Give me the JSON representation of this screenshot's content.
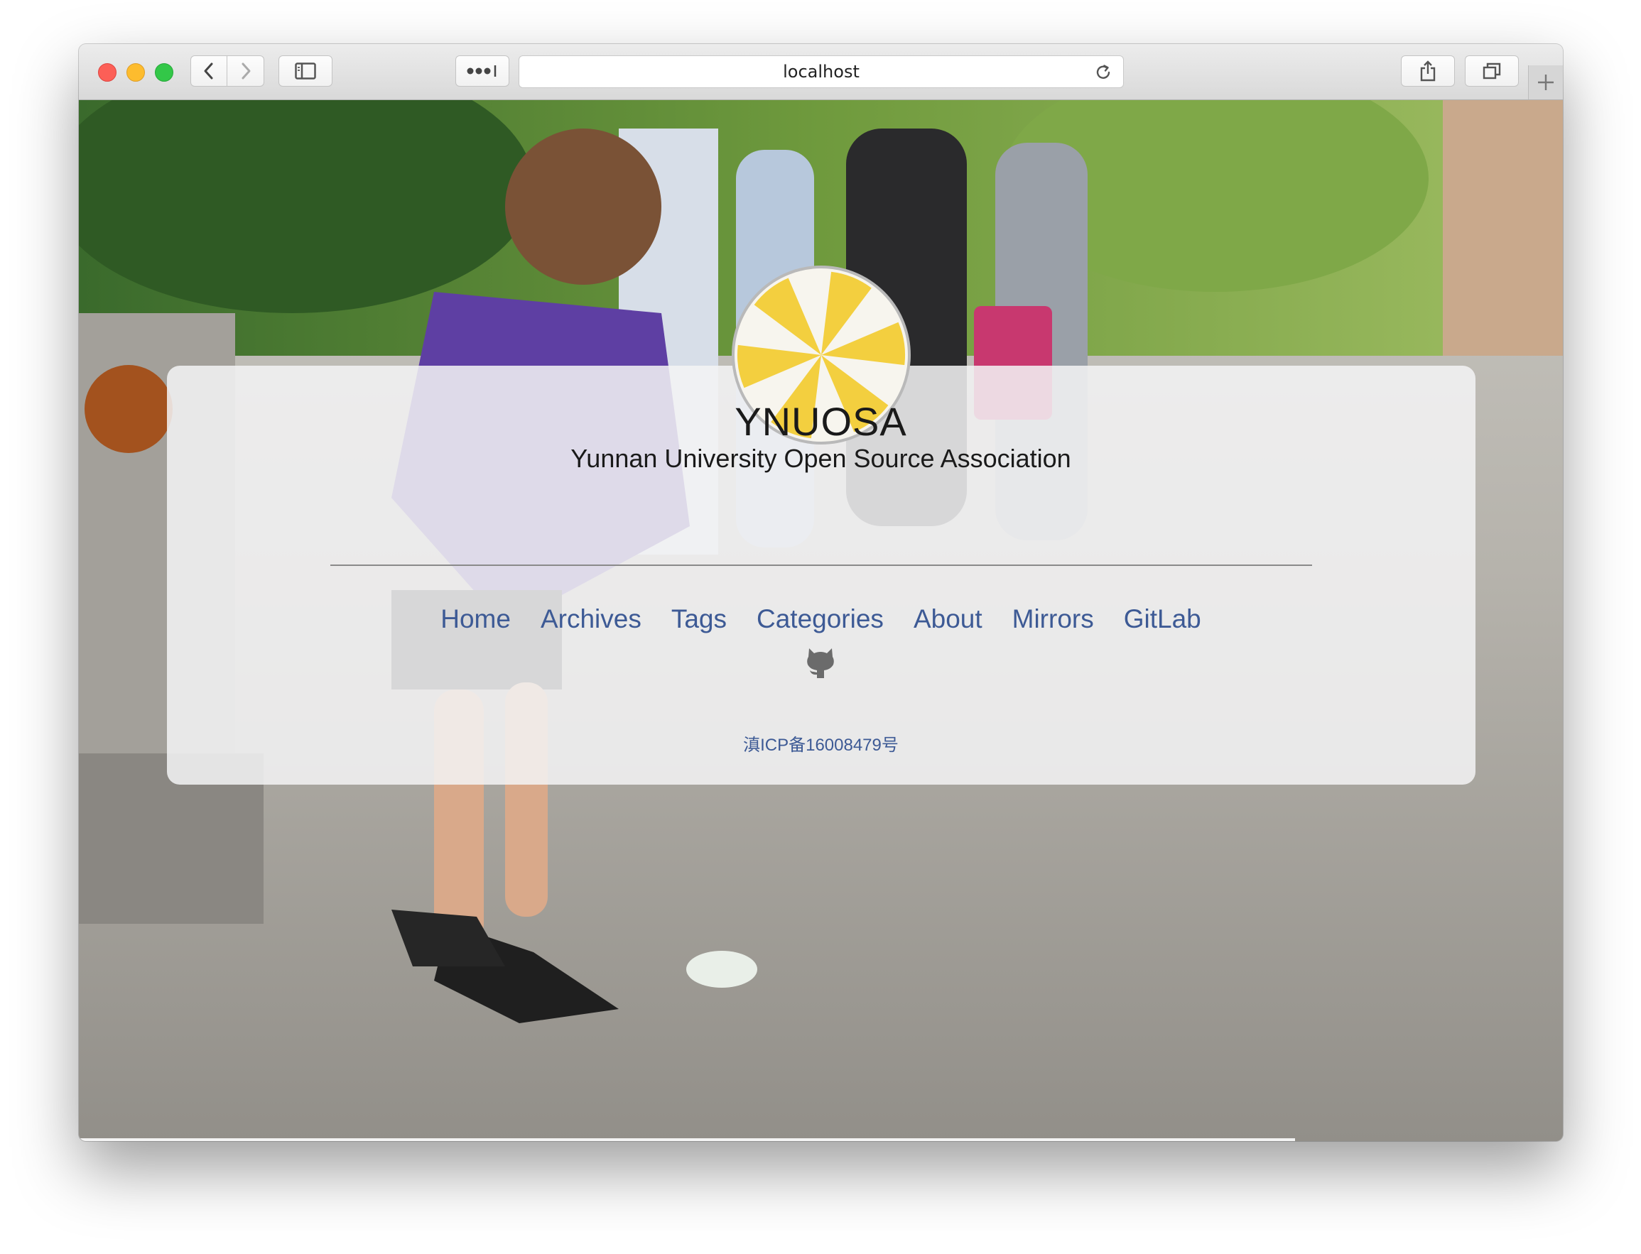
{
  "browser": {
    "url": "localhost",
    "colors": {
      "close": "#fc5f57",
      "minimize": "#fdbc2e",
      "zoom": "#33c748"
    },
    "toolbar_icons": [
      "chevron-left-icon",
      "chevron-right-icon",
      "sidebar-icon",
      "more-icon",
      "reload-icon",
      "share-icon",
      "tabs-overview-icon",
      "plus-icon"
    ]
  },
  "page": {
    "logo_icon": "pinwheel-logo",
    "title": "YNUOSA",
    "subtitle": "Yunnan University Open Source Association",
    "nav": [
      "Home",
      "Archives",
      "Tags",
      "Categories",
      "About",
      "Mirrors",
      "GitLab"
    ],
    "social_icon": "github-icon",
    "icp": "滇ICP备16008479号",
    "colors": {
      "link": "#3d5a95",
      "logo_yellow": "#f3cf3f",
      "card": "#f3f3f5"
    }
  }
}
